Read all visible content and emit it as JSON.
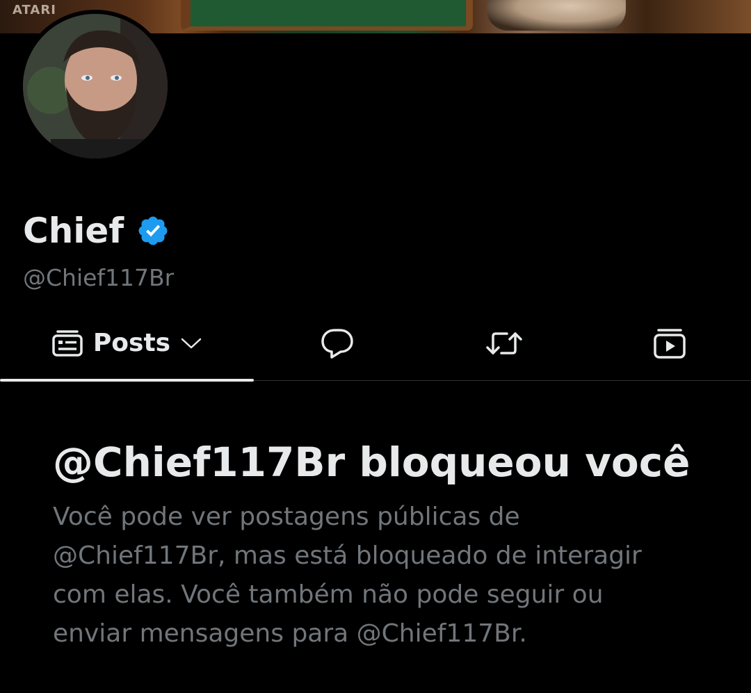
{
  "banner": {
    "logo_text": "ATARI"
  },
  "profile": {
    "display_name": "Chief",
    "handle": "@Chief117Br",
    "verified": true,
    "verified_color": "#1d9bf0"
  },
  "tabs": [
    {
      "label": "Posts",
      "icon": "posts-icon",
      "has_dropdown": true,
      "active": true
    },
    {
      "label": "",
      "icon": "reply-icon",
      "active": false
    },
    {
      "label": "",
      "icon": "repost-icon",
      "active": false
    },
    {
      "label": "",
      "icon": "media-icon",
      "active": false
    }
  ],
  "blocked": {
    "title": "@Chief117Br bloqueou você",
    "body": "Você pode ver postagens públicas de @Chief117Br, mas está bloqueado de interagir com elas. Você também não pode seguir ou enviar mensagens para @Chief117Br."
  },
  "colors": {
    "background": "#000000",
    "text_primary": "#e7e9ea",
    "text_secondary": "#71767b",
    "divider": "#2f3336"
  }
}
